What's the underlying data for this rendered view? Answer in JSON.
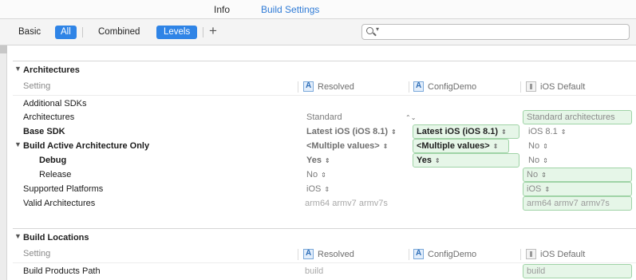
{
  "tabs": {
    "info": "Info",
    "build_settings": "Build Settings"
  },
  "filter": {
    "basic": "Basic",
    "all": "All",
    "combined": "Combined",
    "levels": "Levels",
    "add": "+",
    "search_value": ""
  },
  "columns": {
    "setting": "Setting",
    "resolved": "Resolved",
    "target": "ConfigDemo",
    "default": "iOS Default"
  },
  "sections": [
    {
      "title": "Architectures",
      "rows": [
        {
          "name": "Additional SDKs",
          "resolved": "",
          "target": "",
          "default": ""
        },
        {
          "name": "Architectures",
          "resolved": "Standard",
          "target": "",
          "default": "Standard architectures"
        },
        {
          "name": "Base SDK",
          "resolved": "Latest iOS (iOS 8.1)",
          "target": "Latest iOS (iOS 8.1)",
          "default": "iOS 8.1"
        },
        {
          "name": "Build Active Architecture Only",
          "resolved": "<Multiple values>",
          "target": "<Multiple values>",
          "default": "No"
        },
        {
          "name": "Debug",
          "resolved": "Yes",
          "target": "Yes",
          "default": "No"
        },
        {
          "name": "Release",
          "resolved": "No",
          "target": "",
          "default": "No"
        },
        {
          "name": "Supported Platforms",
          "resolved": "iOS",
          "target": "",
          "default": "iOS"
        },
        {
          "name": "Valid Architectures",
          "resolved": "arm64 armv7 armv7s",
          "target": "",
          "default": "arm64 armv7 armv7s"
        }
      ]
    },
    {
      "title": "Build Locations",
      "rows": [
        {
          "name": "Build Products Path",
          "resolved": "build",
          "target": "",
          "default": "build"
        }
      ]
    }
  ],
  "colors": {
    "accent": "#2f84e6",
    "tab_active": "#2f7bd6",
    "value_fill": "#e6f6e8",
    "value_border": "#9fd3a6"
  },
  "icons": {
    "search": "magnifier-icon",
    "project": "project-icon",
    "target": "target-icon",
    "sdk": "ios-sdk-icon"
  }
}
